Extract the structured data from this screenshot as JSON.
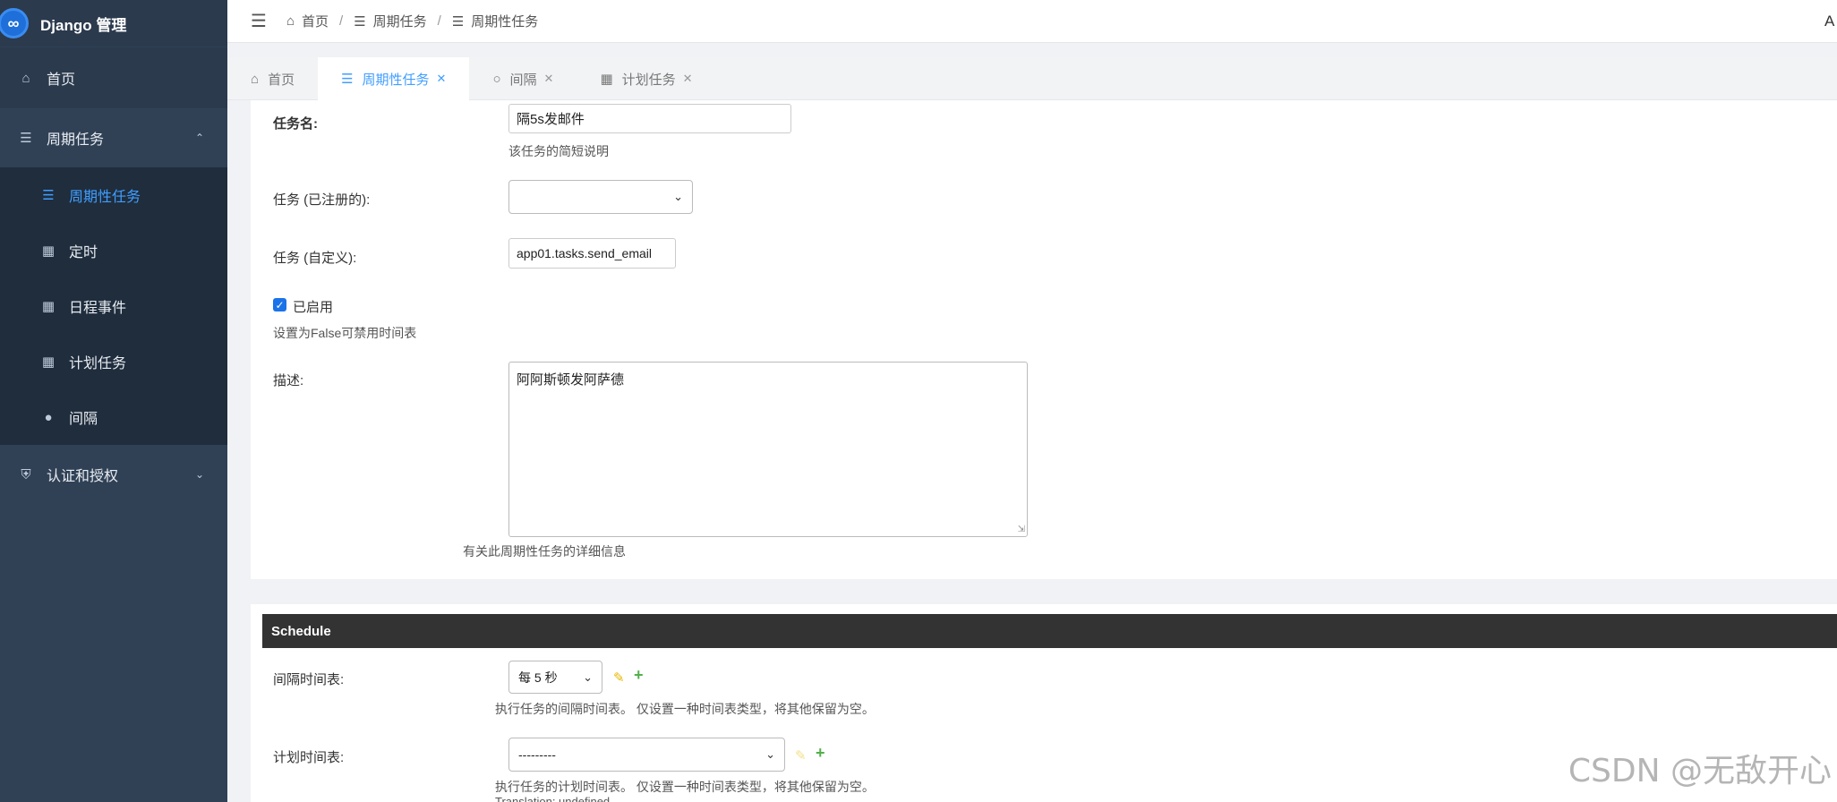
{
  "app": {
    "title": "Django 管理",
    "logo_glyph": "∞"
  },
  "sidebar": {
    "items": [
      {
        "label": "首页",
        "icon": "home-icon"
      },
      {
        "label": "周期任务",
        "icon": "list-icon"
      },
      {
        "label": "认证和授权",
        "icon": "shield-icon"
      }
    ],
    "submenu": [
      {
        "label": "周期性任务",
        "icon": "list-icon",
        "active": true
      },
      {
        "label": "定时",
        "icon": "calendar-icon"
      },
      {
        "label": "日程事件",
        "icon": "calendar-icon"
      },
      {
        "label": "计划任务",
        "icon": "calendar-icon"
      },
      {
        "label": "间隔",
        "icon": "circle-icon"
      }
    ]
  },
  "header": {
    "breadcrumbs": [
      "首页",
      "周期任务",
      "周期性任务"
    ],
    "user_initial": "A"
  },
  "tabs": [
    {
      "label": "首页",
      "icon": "home-icon",
      "closable": false
    },
    {
      "label": "周期性任务",
      "icon": "list-icon",
      "closable": true,
      "active": true
    },
    {
      "label": "间隔",
      "icon": "circle-icon",
      "closable": true
    },
    {
      "label": "计划任务",
      "icon": "calendar-icon",
      "closable": true
    }
  ],
  "form": {
    "name_label": "任务名:",
    "name_value": "隔5s发邮件",
    "name_help": "该任务的简短说明",
    "task_registered_label": "任务 (已注册的):",
    "task_registered_value": "",
    "task_custom_label": "任务 (自定义):",
    "task_custom_value": "app01.tasks.send_email",
    "enabled_label": "已启用",
    "enabled_checked": true,
    "enabled_help": "设置为False可禁用时间表",
    "description_label": "描述:",
    "description_value": "阿阿斯顿发阿萨德",
    "description_help": "有关此周期性任务的详细信息"
  },
  "schedule": {
    "title": "Schedule",
    "interval_label": "间隔时间表:",
    "interval_value": "每 5 秒",
    "interval_help": "执行任务的间隔时间表。 仅设置一种时间表类型，将其他保留为空。",
    "crontab_label": "计划时间表:",
    "crontab_value": "---------",
    "crontab_help": "执行任务的计划时间表。 仅设置一种时间表类型，将其他保留为空。",
    "crontab_help2": "Translation: undefined"
  },
  "watermark": "CSDN @无敌开心"
}
